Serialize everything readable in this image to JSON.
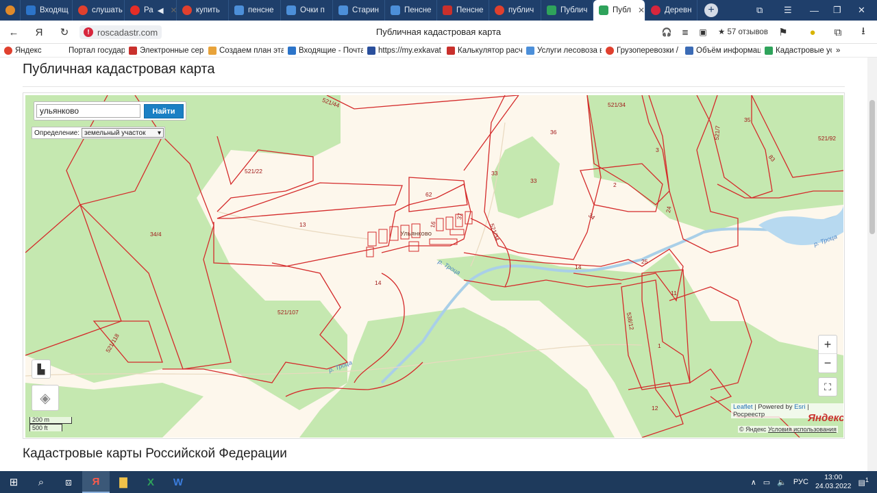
{
  "tabs": [
    {
      "label": "",
      "fav": "#e08a2a",
      "icon": "sun-icon"
    },
    {
      "label": "Входящ",
      "fav": "#2c74c9",
      "icon": "mail-icon"
    },
    {
      "label": "слушать",
      "fav": "#e0402e",
      "icon": "yandex-icon"
    },
    {
      "label": "Ра",
      "fav": "#e52d27",
      "icon": "youtube-icon"
    },
    {
      "label": "купить",
      "fav": "#e0402e",
      "icon": "yandex-icon"
    },
    {
      "label": "пенсне",
      "fav": "#4c8fd9",
      "icon": "grid-icon"
    },
    {
      "label": "Очки п",
      "fav": "#4c8fd9",
      "icon": "grid-icon"
    },
    {
      "label": "Старин",
      "fav": "#4c8fd9",
      "icon": "grid-icon"
    },
    {
      "label": "Пенсне",
      "fav": "#4c8fd9",
      "icon": "grid-icon"
    },
    {
      "label": "Пенсне",
      "fav": "#c9302c",
      "icon": "market-icon"
    },
    {
      "label": "публич",
      "fav": "#e0402e",
      "icon": "yandex-icon"
    },
    {
      "label": "Публич",
      "fav": "#2fa35b",
      "icon": "cadastre-icon"
    },
    {
      "label": "Публ",
      "fav": "#2fa35b",
      "icon": "cadastre-icon",
      "active": true
    },
    {
      "label": "Деревн",
      "fav": "#d7263d",
      "icon": "pin-icon"
    }
  ],
  "address": {
    "url": "roscadastr.com",
    "title": "Публичная кадастровая карта",
    "reviews": "57 отзывов"
  },
  "bookmarks": [
    {
      "label": "Яндекс",
      "color": "#e0402e",
      "icon": "yandex-icon"
    },
    {
      "label": "Портал государст",
      "color": "#ffffff",
      "icon": "gov-icon"
    },
    {
      "label": "Электронные сер",
      "color": "#c9302c",
      "icon": "services-icon"
    },
    {
      "label": "Создаем план эта",
      "color": "#e8a33a",
      "icon": "plan-icon"
    },
    {
      "label": "Входящие - Почта",
      "color": "#2c74c9",
      "icon": "mail-icon"
    },
    {
      "label": "https://my.exkavat",
      "color": "#2a4f9c",
      "icon": "site-icon"
    },
    {
      "label": "Калькулятор расч",
      "color": "#c9302c",
      "icon": "calc-icon"
    },
    {
      "label": "Услуги лесовоза в",
      "color": "#4c8fd9",
      "icon": "grid-icon"
    },
    {
      "label": "Грузоперевозки /",
      "color": "#e0402e",
      "icon": "truck-icon"
    },
    {
      "label": "Объём информац",
      "color": "#3b6bb5",
      "icon": "emblem-icon"
    },
    {
      "label": "Кадастровые ус",
      "color": "#2fa35b",
      "icon": "cadastre-icon"
    }
  ],
  "page": {
    "heading": "Публичная кадастровая карта",
    "subheading": "Кадастровые карты Российской Федерации"
  },
  "map": {
    "search_value": "ульянково",
    "search_button": "Найти",
    "definition_label": "Определение:",
    "definition_value": "земельный участок",
    "scale_metric": "200 m",
    "scale_imperial": "500 ft",
    "attribution_leaflet": "Leaflet",
    "attribution_sep1": " | Powered by ",
    "attribution_esri": "Esri",
    "attribution_sep2": " | Росреестр",
    "yandex_logo": "Яндекс",
    "copyright": "© Яндекс",
    "terms": "Условия использования",
    "village": "Ульянково",
    "parcels": [
      "521/44",
      "521/34",
      "36",
      "35",
      "521/7",
      "521/92",
      "3",
      "83",
      "521/22",
      "33",
      "33",
      "2",
      "62",
      "24",
      "13",
      "34/4",
      "16",
      "37",
      "34",
      "521/34",
      "25",
      "14",
      "14",
      "11",
      "521/107",
      "538/12",
      "1",
      "521/118",
      "12"
    ],
    "rivers": [
      "р. Троца",
      "р. Троца",
      "р. Троца"
    ],
    "colors": {
      "forest": "#c5e8b0",
      "open": "#fdf7ec",
      "water": "#b7d9f0",
      "parcel": "#d42a2a"
    }
  },
  "taskbar": {
    "lang": "РУС",
    "time": "13:00",
    "date": "24.03.2022",
    "notifications": "1"
  }
}
